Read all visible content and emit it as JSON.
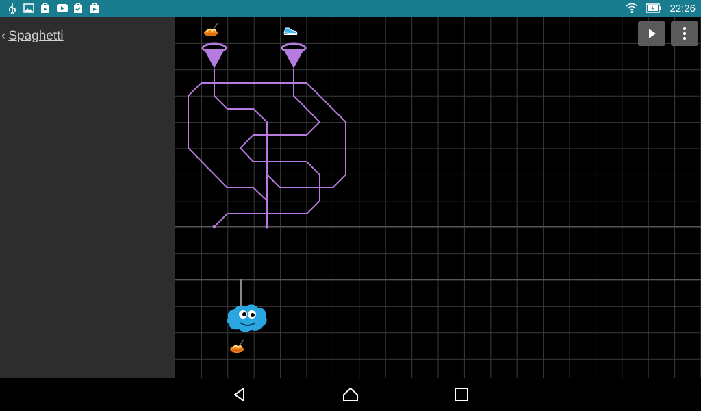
{
  "status_bar": {
    "time": "22:26",
    "icons": [
      "usb-icon",
      "image-icon",
      "play-store-icon",
      "youtube-icon",
      "shopping-bag-icon",
      "shopping-bag-icon",
      "wifi-icon",
      "battery-charging-icon"
    ]
  },
  "sidebar": {
    "back_label": "Spaghetti"
  },
  "toolbar": {
    "icons": [
      "play-icon",
      "more-vert-icon"
    ]
  },
  "navigation": {
    "icons": [
      "back-icon",
      "home-icon",
      "recents-icon"
    ]
  },
  "colors": {
    "status_bar": "#1a7d8f",
    "sidebar": "#2d2d2d",
    "grid_line": "#3a3a3a",
    "path": "#b57be0",
    "character": "#2aa7e0"
  }
}
